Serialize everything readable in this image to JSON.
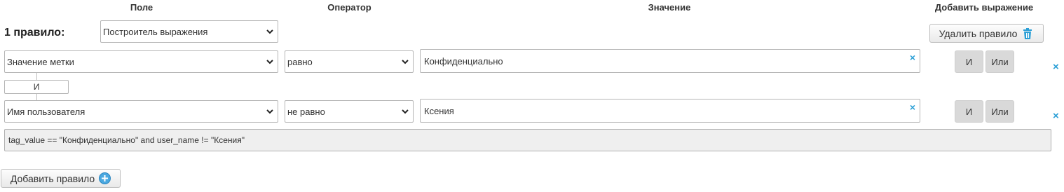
{
  "headers": {
    "field": "Поле",
    "operator": "Оператор",
    "value": "Значение",
    "add_expression": "Добавить выражение"
  },
  "rule": {
    "title": "1 правило:",
    "builder_select": "Построитель выражения",
    "delete_label": "Удалить правило",
    "conditions": [
      {
        "field": "Значение метки",
        "operator": "равно",
        "value": "Конфиденциально",
        "and_label": "И",
        "or_label": "Или"
      },
      {
        "field": "Имя пользователя",
        "operator": "не равно",
        "value": "Ксения",
        "and_label": "И",
        "or_label": "Или"
      }
    ],
    "connector": "И",
    "expression": "tag_value == \"Конфиденциально\" and user_name != \"Ксения\""
  },
  "add_rule_label": "Добавить правило",
  "icons": {
    "clear": "×",
    "remove": "×",
    "trash": "trash-icon",
    "plus": "plus-circle-icon",
    "chevron": "chevron-down-icon"
  },
  "colors": {
    "accent": "#2a9fd6",
    "button_gray": "#d9d9d9",
    "expression_bg": "#efefef"
  }
}
